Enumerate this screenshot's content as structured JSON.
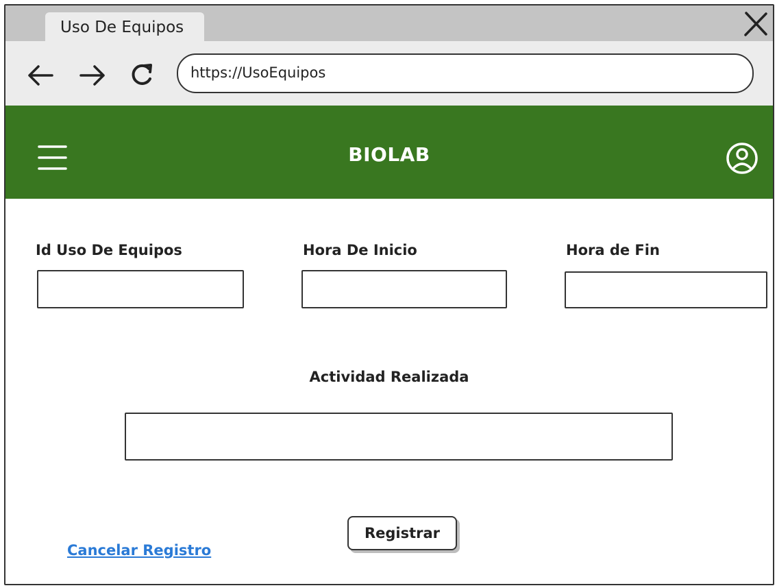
{
  "browser": {
    "tab_title": "Uso De Equipos",
    "url": "https://UsoEquipos"
  },
  "app": {
    "brand": "BIOLAB",
    "header_color": "#397720"
  },
  "form": {
    "id_label": "Id Uso De Equipos",
    "id_value": "",
    "start_label": "Hora De Inicio",
    "start_value": "",
    "end_label": "Hora de Fin",
    "end_value": "",
    "activity_label": "Actividad Realizada",
    "activity_value": ""
  },
  "actions": {
    "submit_label": "Registrar",
    "cancel_label": "Cancelar Registro",
    "link_color": "#2a7ad6"
  },
  "icons": [
    "close-icon",
    "back-arrow-icon",
    "forward-arrow-icon",
    "reload-icon",
    "hamburger-menu-icon",
    "user-account-icon"
  ]
}
